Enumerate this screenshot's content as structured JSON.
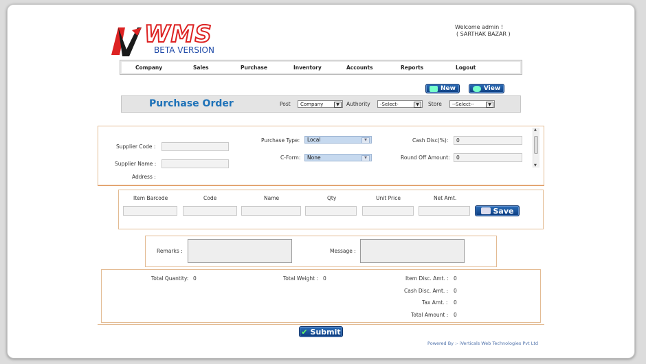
{
  "app": {
    "brand": "WMS",
    "subtitle": "BETA VERSION"
  },
  "user": {
    "welcome": "Welcome admin !",
    "store": "( SARTHAK BAZAR )"
  },
  "nav": [
    "Company",
    "Sales",
    "Purchase",
    "Inventory",
    "Accounts",
    "Reports",
    "Logout"
  ],
  "actions": {
    "new": "New",
    "view": "View"
  },
  "page_title": "Purchase Order",
  "filters": {
    "post_label": "Post",
    "post_value": "Company",
    "authority_label": "Authority",
    "authority_value": "-Select-",
    "store_label": "Store",
    "store_value": "--Select--"
  },
  "header_form": {
    "supplier_code_label": "Supplier Code :",
    "supplier_name_label": "Supplier Name :",
    "address_label": "Address :",
    "purchase_type_label": "Purchase Type:",
    "purchase_type_value": "Local",
    "cform_label": "C-Form:",
    "cform_value": "None",
    "cash_disc_label": "Cash Disc(%):",
    "cash_disc_value": "0",
    "round_off_label": "Round Off Amount:",
    "round_off_value": "0"
  },
  "item_grid": {
    "headers": [
      "Item Barcode",
      "Code",
      "Name",
      "Qty",
      "Unit Price",
      "Net Amt."
    ],
    "save_label": "Save"
  },
  "notes": {
    "remarks_label": "Remarks :",
    "message_label": "Message :"
  },
  "totals": {
    "total_quantity_label": "Total Quantity:",
    "total_quantity": "0",
    "total_weight_label": "Total Weight :",
    "total_weight": "0",
    "item_disc_label": "Item Disc. Amt. :",
    "item_disc": "0",
    "cash_disc_label": "Cash Disc. Amt. :",
    "cash_disc": "0",
    "tax_label": "Tax Amt. :",
    "tax": "0",
    "total_amount_label": "Total Amount :",
    "total_amount": "0"
  },
  "submit_label": "Submit",
  "footer": "Powered By :- iVerticals Web Technologies Pvt Ltd",
  "colors": {
    "accent": "#1e72b8",
    "button": "#0e3d80",
    "panel_border": "#e3bb93",
    "logo_red": "#d22222"
  }
}
